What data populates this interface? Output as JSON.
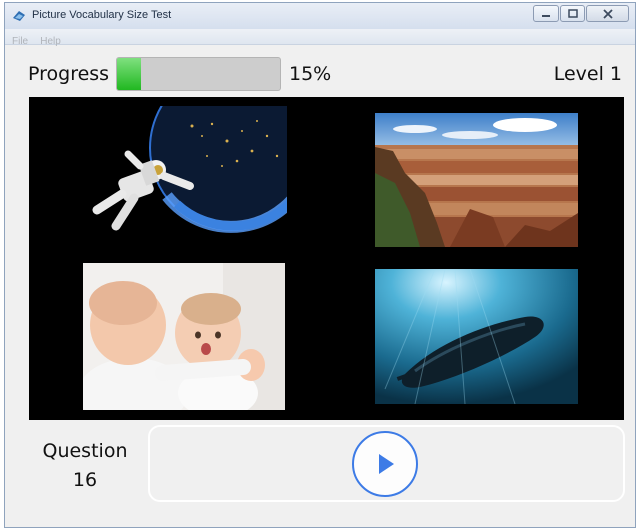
{
  "window": {
    "title": "Picture Vocabulary Size Test",
    "menu": [
      "File",
      "Help"
    ]
  },
  "header": {
    "progress_label": "Progress",
    "progress_value": 0.15,
    "progress_text": "15%",
    "level_text": "Level 1"
  },
  "choices": [
    {
      "icon": "astronaut-earth-image"
    },
    {
      "icon": "grand-canyon-image"
    },
    {
      "icon": "two-babies-image"
    },
    {
      "icon": "boat-underwater-image"
    }
  ],
  "footer": {
    "question_label": "Question",
    "question_number": "16"
  },
  "colors": {
    "progress_fill": "#21b821",
    "play_accent": "#3d7be6",
    "stage_bg": "#000000"
  }
}
